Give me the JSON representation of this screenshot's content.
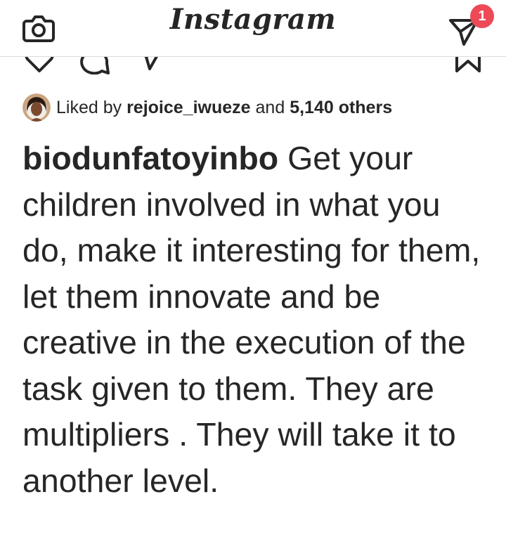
{
  "header": {
    "logo_text": "Instagram",
    "camera_icon": "camera-icon",
    "direct_icon": "direct-message-icon",
    "notification_count": "1"
  },
  "actions": {
    "icons": [
      "heart-icon",
      "comment-icon",
      "share-icon",
      "bookmark-icon"
    ]
  },
  "likes": {
    "prefix": "Liked by",
    "user": "rejoice_iwueze",
    "conjunction": "and",
    "others": "5,140 others"
  },
  "caption": {
    "username": "biodunfatoyinbo",
    "text": "Get your children involved in what you do, make it interesting for them, let them innovate and be creative in the execution of the task given to them. They are multipliers . They will take it to another level."
  },
  "colors": {
    "text": "#262626",
    "badge": "#ed4956",
    "divider": "#dbdbdb"
  }
}
